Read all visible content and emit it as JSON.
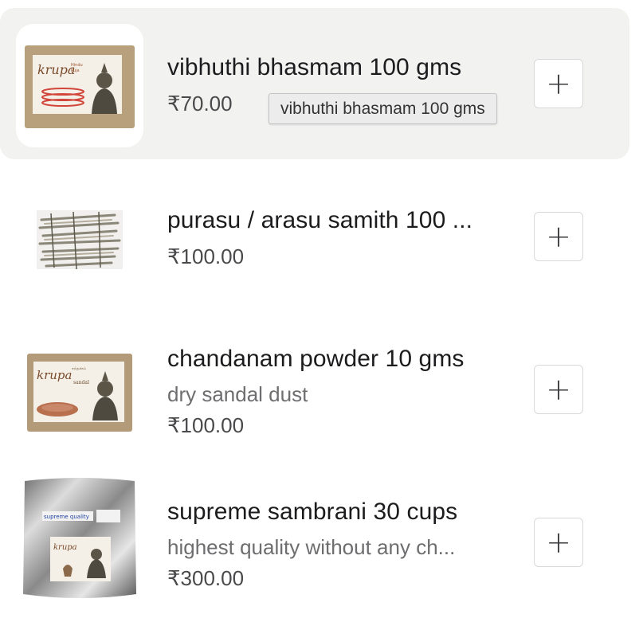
{
  "products": [
    {
      "name": "vibhuthi bhasmam 100 gms",
      "description": "",
      "price": "₹70.00",
      "add_label": "+",
      "brand_text": "krupa",
      "pack_text": "Hindu Puja vibhuthi"
    },
    {
      "name": "purasu / arasu samith 100 ...",
      "description": "",
      "price": "₹100.00",
      "add_label": "+"
    },
    {
      "name": "chandanam powder 10 gms",
      "description": "dry sandal dust",
      "price": "₹100.00",
      "add_label": "+",
      "brand_text": "krupa",
      "pack_text": "சந்தனம் sandal"
    },
    {
      "name": "supreme sambrani 30 cups",
      "description": "highest quality without any ch...",
      "price": "₹300.00",
      "add_label": "+",
      "brand_text": "krupa",
      "pack_text": "supreme quality"
    }
  ],
  "tooltip": {
    "text": "vibhuthi bhasmam 100 gms"
  },
  "colors": {
    "hover_row": "#f2f2f1",
    "text": "#1c1c1e",
    "muted": "#6e6e70",
    "package_kraft": "#b39a78"
  }
}
